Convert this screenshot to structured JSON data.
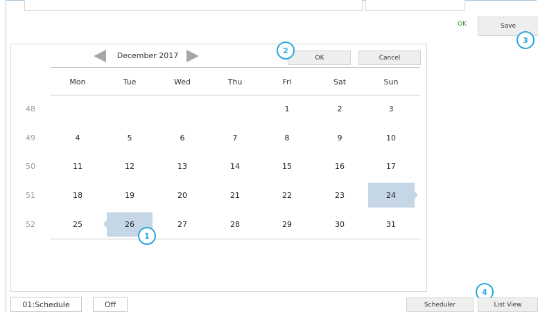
{
  "header": {
    "status_text": "OK",
    "save_label": "Save"
  },
  "calendar": {
    "month_label": "December 2017",
    "ok_label": "OK",
    "cancel_label": "Cancel",
    "weekdays": [
      "Mon",
      "Tue",
      "Wed",
      "Thu",
      "Fri",
      "Sat",
      "Sun"
    ],
    "weeks": [
      {
        "num": "48",
        "days": [
          "",
          "",
          "",
          "",
          "1",
          "2",
          "3"
        ]
      },
      {
        "num": "49",
        "days": [
          "4",
          "5",
          "6",
          "7",
          "8",
          "9",
          "10"
        ]
      },
      {
        "num": "50",
        "days": [
          "11",
          "12",
          "13",
          "14",
          "15",
          "16",
          "17"
        ]
      },
      {
        "num": "51",
        "days": [
          "18",
          "19",
          "20",
          "21",
          "22",
          "23",
          "24"
        ]
      },
      {
        "num": "52",
        "days": [
          "25",
          "26",
          "27",
          "28",
          "29",
          "30",
          "31"
        ]
      }
    ],
    "selected_start": "26",
    "selected_end": "24"
  },
  "footer": {
    "schedule_label": "01:Schedule",
    "off_label": "Off",
    "scheduler_label": "Scheduler",
    "list_view_label": "List View"
  },
  "callouts": [
    "1",
    "2",
    "3",
    "4"
  ],
  "colors": {
    "accent": "#2aa7dd",
    "selection": "#c5d6e6",
    "status_ok": "#2e8b2e"
  }
}
